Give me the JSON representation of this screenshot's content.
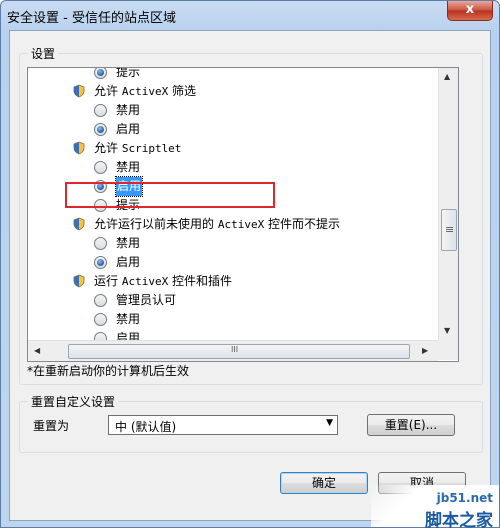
{
  "window": {
    "title": "安全设置 - 受信任的站点区域",
    "close_label": "x"
  },
  "settings_group": {
    "label": "设置"
  },
  "settings_list": [
    {
      "type": "radio",
      "label": "提示",
      "checked": true,
      "selected": false
    },
    {
      "type": "header",
      "label_prefix": "允许 ",
      "label_mono": "ActiveX",
      "label_suffix": " 筛选"
    },
    {
      "type": "radio",
      "label": "禁用",
      "checked": false,
      "selected": false
    },
    {
      "type": "radio",
      "label": "启用",
      "checked": true,
      "selected": false
    },
    {
      "type": "header",
      "label_prefix": "允许 ",
      "label_mono": "Scriptlet",
      "label_suffix": ""
    },
    {
      "type": "radio",
      "label": "禁用",
      "checked": false,
      "selected": false
    },
    {
      "type": "radio",
      "label": "启用",
      "checked": true,
      "selected": true
    },
    {
      "type": "radio",
      "label": "提示",
      "checked": false,
      "selected": false
    },
    {
      "type": "header",
      "label_prefix": "允许运行以前未使用的 ",
      "label_mono": "ActiveX",
      "label_suffix": " 控件而不提示"
    },
    {
      "type": "radio",
      "label": "禁用",
      "checked": false,
      "selected": false
    },
    {
      "type": "radio",
      "label": "启用",
      "checked": true,
      "selected": false
    },
    {
      "type": "header",
      "label_prefix": "运行 ",
      "label_mono": "ActiveX",
      "label_suffix": " 控件和插件"
    },
    {
      "type": "radio",
      "label": "管理员认可",
      "checked": false,
      "selected": false
    },
    {
      "type": "radio",
      "label": "禁用",
      "checked": false,
      "selected": false
    },
    {
      "type": "radio",
      "label": "启用",
      "checked": false,
      "selected": false
    }
  ],
  "scrollbar": {
    "h_grip": "III",
    "v_grip": "≡"
  },
  "note": "*在重新启动你的计算机后生效",
  "reset_group": {
    "label": "重置自定义设置",
    "reset_to_label": "重置为",
    "combo_value": "中 (默认值)",
    "reset_button": "重置(E)..."
  },
  "footer": {
    "ok_button": "确定",
    "cancel_button": "取消"
  },
  "watermark": {
    "line1": "jb51.net",
    "line2": "脚本之家"
  },
  "colors": {
    "highlight_box": "#e0262b",
    "selection": "#3399ff"
  }
}
